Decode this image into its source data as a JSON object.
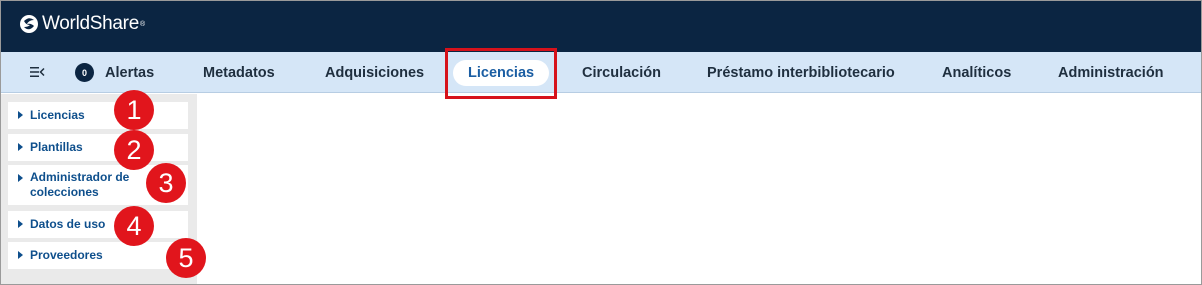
{
  "brand": {
    "name": "WorldShare",
    "registered": "®"
  },
  "nav": {
    "alerts_count": "0",
    "items": [
      "Alertas",
      "Metadatos",
      "Adquisiciones",
      "Licencias",
      "Circulación",
      "Préstamo interbibliotecario",
      "Analíticos",
      "Administración"
    ],
    "active": "Licencias"
  },
  "sidebar": {
    "items": [
      {
        "label": "Licencias"
      },
      {
        "label": "Plantillas"
      },
      {
        "label_line1": "Administrador de",
        "label_line2": "colecciones"
      },
      {
        "label": "Datos de uso"
      },
      {
        "label": "Proveedores"
      }
    ]
  },
  "callouts": [
    "1",
    "2",
    "3",
    "4",
    "5"
  ],
  "colors": {
    "topbar": "#0b2542",
    "navbar": "#d5e6f7",
    "accent": "#1b5ea3",
    "callout": "#e1151c"
  }
}
